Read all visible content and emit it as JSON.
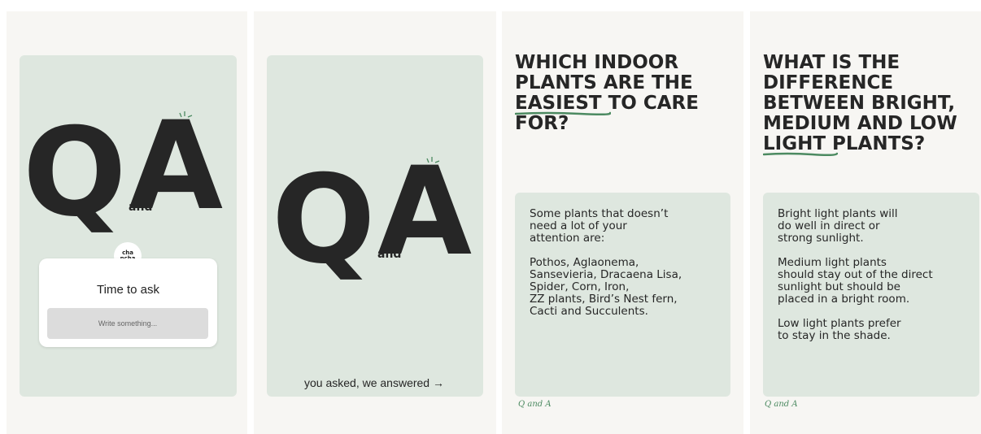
{
  "slide1": {
    "big_q": "Q",
    "big_a": "A",
    "and": "and",
    "logo_line1": "cha",
    "logo_line2": "ncha",
    "ask_title": "Time to ask",
    "ask_placeholder": "Write something..."
  },
  "slide2": {
    "big_q": "Q",
    "big_a": "A",
    "and": "and",
    "footer": "you asked, we answered →"
  },
  "slide3": {
    "q_lines": [
      "WHICH INDOOR",
      "PLANTS ARE THE"
    ],
    "q_underlined": "EASIEST",
    "q_after_underlined": " TO CARE",
    "q_last": "FOR?",
    "answer": [
      "Some plants that doesn’t\nneed a lot of your\nattention are:",
      "Pothos, Aglaonema,\nSansevieria, Dracaena Lisa,\nSpider, Corn, Iron,\nZZ plants, Bird’s Nest fern,\nCacti and Succulents."
    ],
    "signature": "Q and A"
  },
  "slide4": {
    "q_lines": [
      "WHAT IS THE",
      "DIFFERENCE",
      "BETWEEN BRIGHT,",
      "MEDIUM AND LOW"
    ],
    "q_underlined": "LIGHT",
    "q_after_underlined": " PLANTS?",
    "answer": [
      "Bright light plants will\ndo well in direct or\nstrong sunlight.",
      "Medium light plants\nshould stay out of the direct\nsunlight but should be\nplaced in a bright room.",
      "Low light plants prefer\nto stay in the shade."
    ],
    "signature": "Q and A"
  },
  "colors": {
    "card": "#dee7df",
    "panel": "#f7f6f3",
    "accent_green": "#4c8a61",
    "text_dark": "#262626"
  }
}
